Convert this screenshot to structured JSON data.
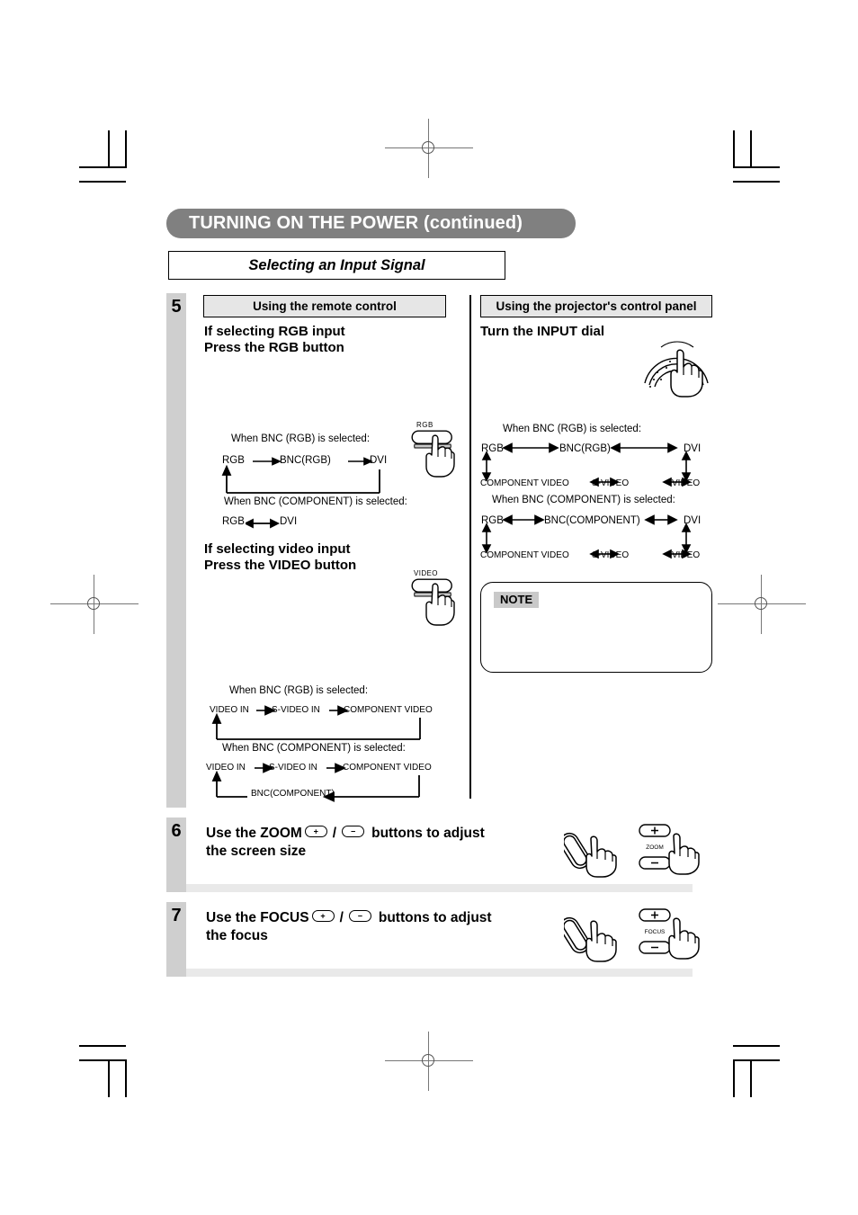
{
  "header": {
    "title": "TURNING ON THE POWER (continued)",
    "subtitle": "Selecting an Input Signal"
  },
  "step5": {
    "number": "5",
    "left_column": {
      "heading": "Using the remote control",
      "rgb_section": {
        "line1": "If selecting RGB input",
        "line2": "Press the RGB button",
        "button_label": "RGB",
        "case1_caption": "When BNC (RGB) is selected:",
        "case1_nodes": [
          "RGB",
          "BNC(RGB)",
          "DVI"
        ],
        "case2_caption": "When BNC (COMPONENT) is selected:",
        "case2_nodes": [
          "RGB",
          "DVI"
        ]
      },
      "video_section": {
        "line1": "If selecting video input",
        "line2": "Press the VIDEO button",
        "button_label": "VIDEO",
        "case1_caption": "When BNC (RGB) is selected:",
        "case1_nodes": [
          "VIDEO IN",
          "S-VIDEO IN",
          "COMPONENT VIDEO"
        ],
        "case2_caption": "When BNC (COMPONENT) is selected:",
        "case2_nodes": [
          "VIDEO IN",
          "S-VIDEO IN",
          "COMPONENT VIDEO"
        ],
        "case2_loop_node": "BNC(COMPONENT)"
      }
    },
    "right_column": {
      "heading": "Using the projector's control panel",
      "dial_heading": "Turn the INPUT dial",
      "case1_caption": "When BNC (RGB) is selected:",
      "case1_top": [
        "RGB",
        "BNC(RGB)",
        "DVI"
      ],
      "case1_bottom": [
        "COMPONENT VIDEO",
        "S-VIDEO",
        "VIDEO"
      ],
      "case2_caption": "When BNC (COMPONENT) is selected:",
      "case2_top": [
        "RGB",
        "BNC(COMPONENT)",
        "DVI"
      ],
      "case2_bottom": [
        "COMPONENT VIDEO",
        "S-VIDEO",
        "VIDEO"
      ],
      "note_label": "NOTE",
      "note_text": ""
    }
  },
  "step6": {
    "number": "6",
    "text_before": "Use the ZOOM",
    "plus": "+",
    "slash": "/",
    "minus": "−",
    "text_after": "buttons to adjust",
    "text_line2": "the screen size",
    "remote_label": "ZOOM"
  },
  "step7": {
    "number": "7",
    "text_before": "Use the FOCUS",
    "plus": "+",
    "slash": "/",
    "minus": "−",
    "text_after": "buttons to adjust",
    "text_line2": "the focus",
    "remote_label": "FOCUS"
  }
}
